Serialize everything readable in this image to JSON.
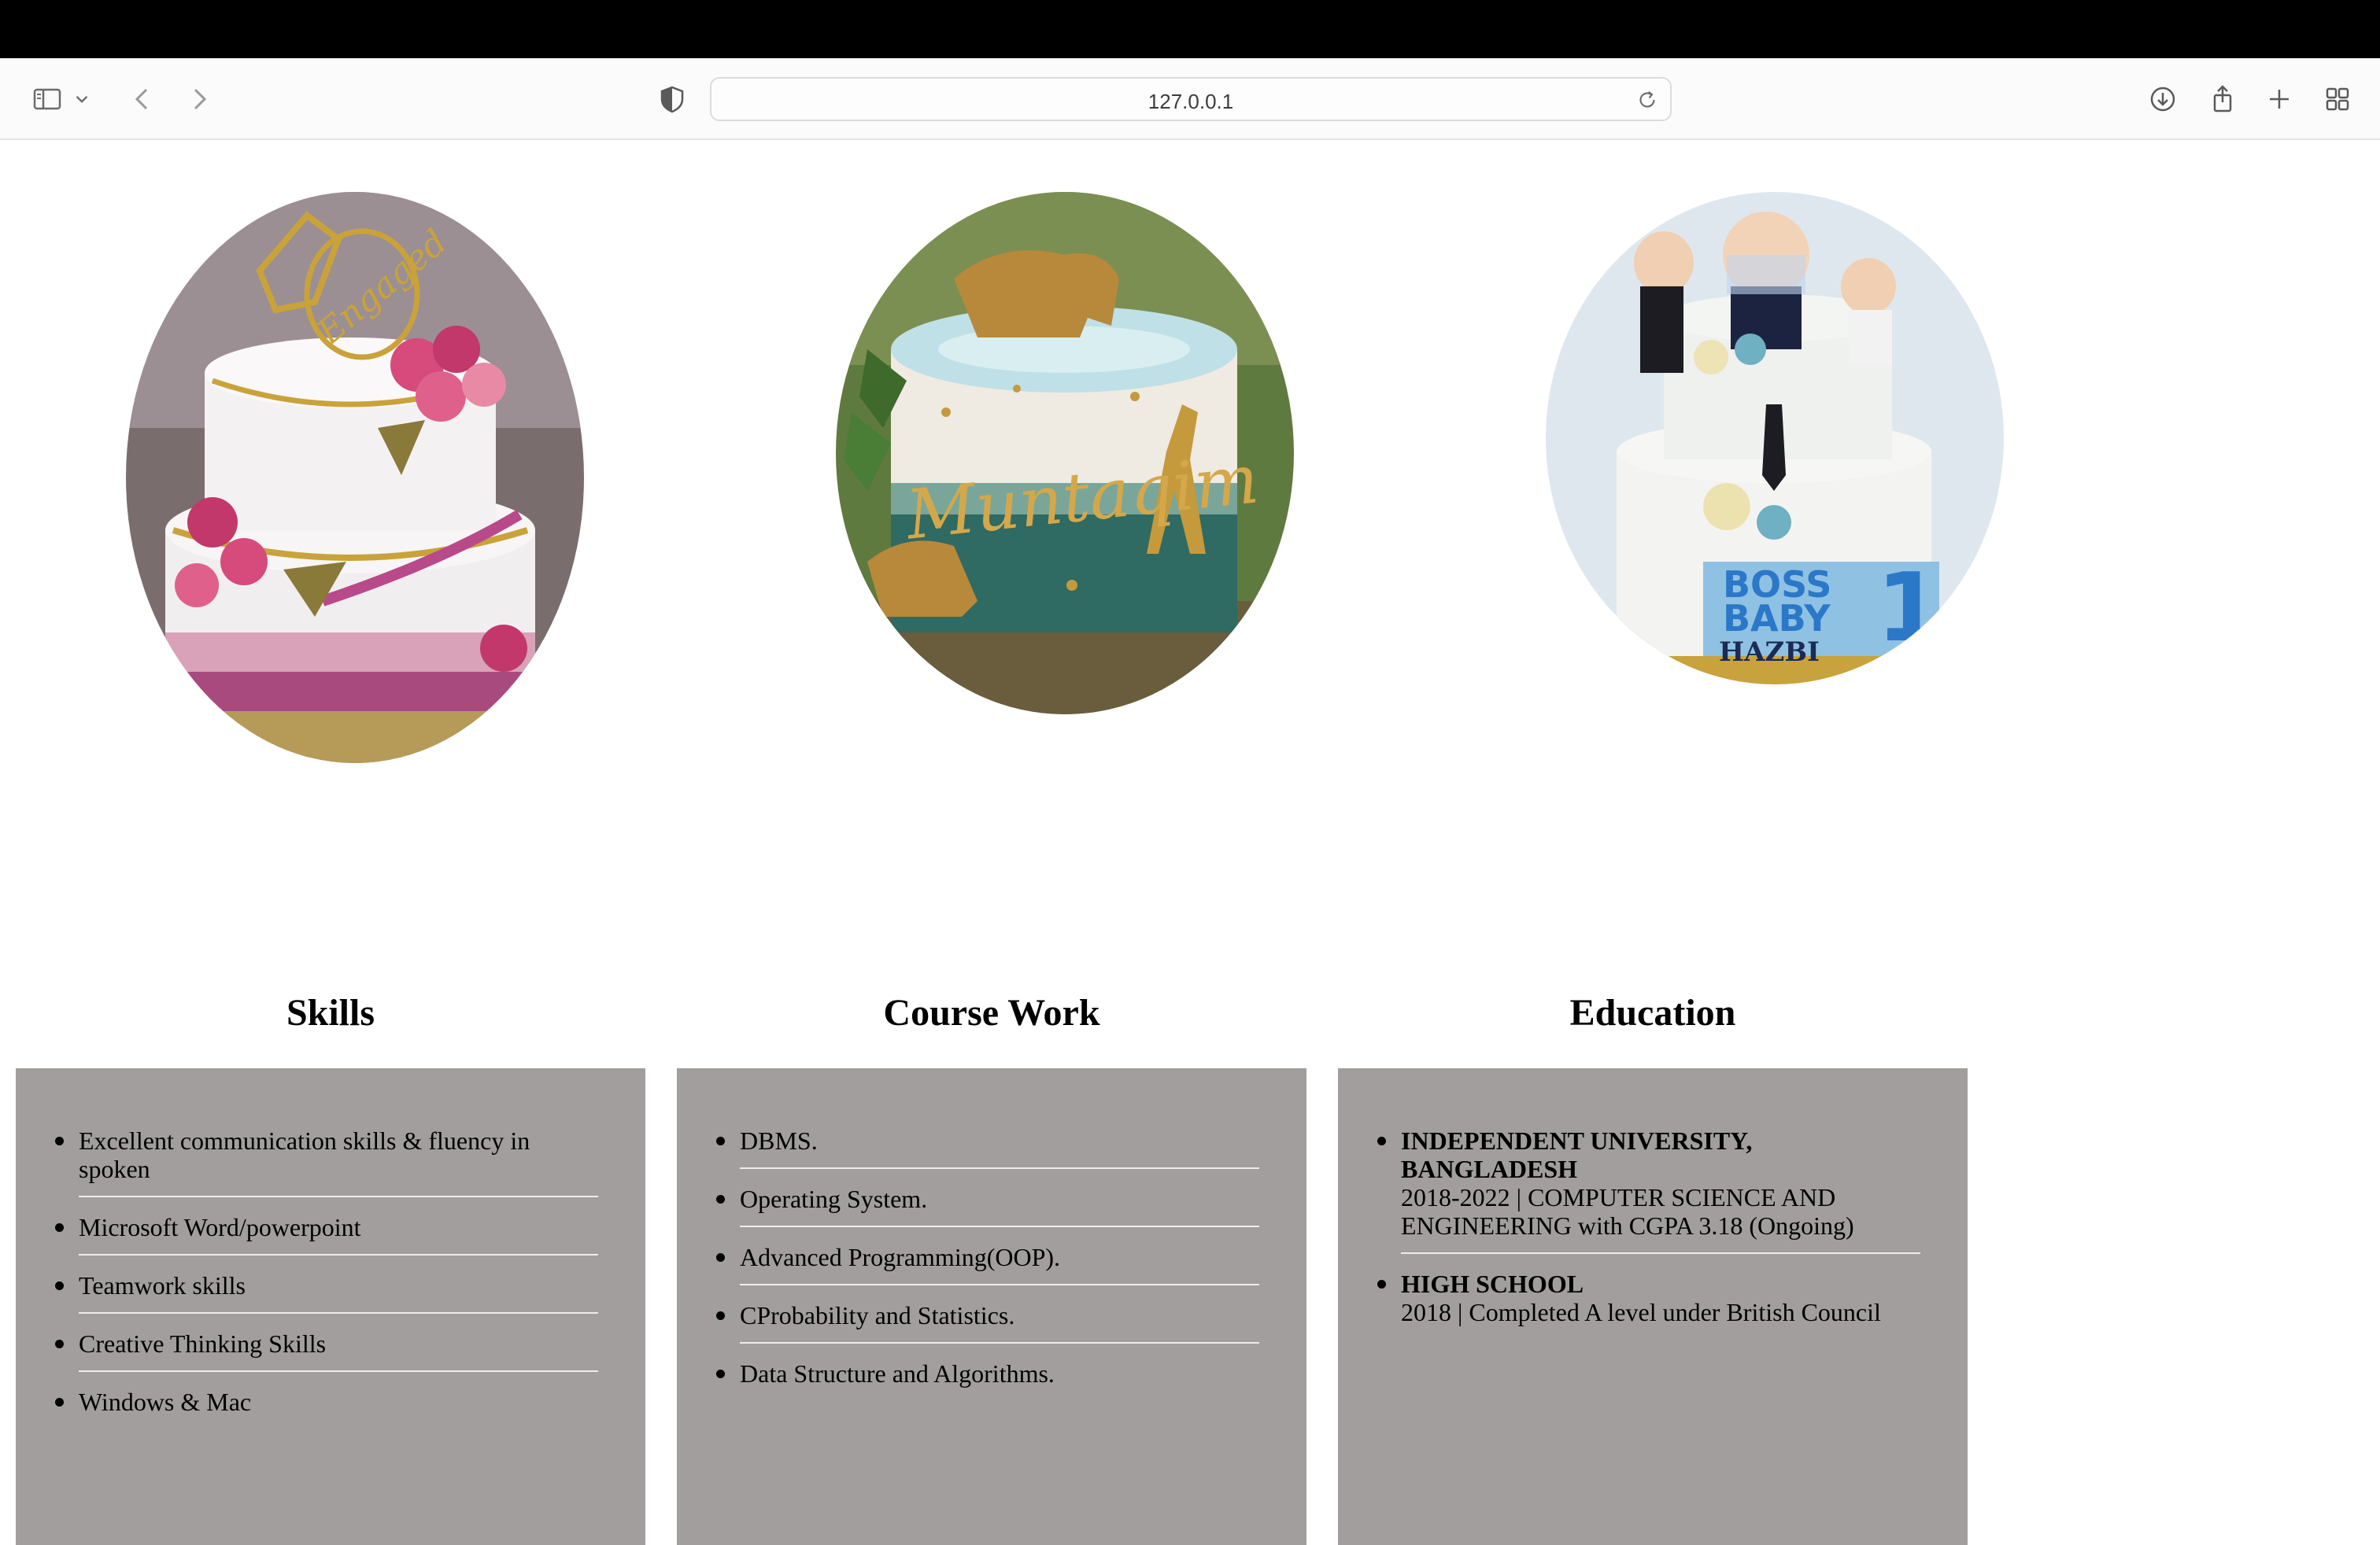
{
  "browser": {
    "url": "127.0.0.1"
  },
  "images": [
    {
      "alt": "engagement-cake",
      "colors": [
        "#f2eff0",
        "#d64a7c",
        "#c9a23a",
        "#6b5a55"
      ]
    },
    {
      "alt": "muntaqim-cake",
      "colors": [
        "#2f6a63",
        "#f1ede4",
        "#c49a3c",
        "#4a6d2f"
      ]
    },
    {
      "alt": "boss-baby-hazbi-cake",
      "colors": [
        "#eaf2f8",
        "#5aa7d8",
        "#c9a23a",
        "#1c2340"
      ]
    }
  ],
  "cake_texts": {
    "cake1_topper": "Engaged",
    "cake2_name": "Muntaqim",
    "cake3_line1": "BOSS",
    "cake3_line2": "BABY",
    "cake3_name": "HAZBI",
    "cake3_number": "1"
  },
  "sections": {
    "skills": {
      "title": "Skills",
      "items": [
        "Excellent communication skills & fluency in spoken",
        "Microsoft Word/powerpoint",
        "Teamwork skills",
        "Creative Thinking Skills",
        "Windows & Mac"
      ]
    },
    "coursework": {
      "title": "Course Work",
      "items": [
        "DBMS.",
        "Operating System.",
        "Advanced Programming(OOP).",
        "CProbability and Statistics.",
        "Data Structure and Algorithms."
      ]
    },
    "education": {
      "title": "Education",
      "items": [
        {
          "name": "INDEPENDENT UNIVERSITY, BANGLADESH",
          "detail": "2018-2022 | COMPUTER SCIENCE AND ENGINEERING with CGPA 3.18 (Ongoing)"
        },
        {
          "name": "HIGH SCHOOL",
          "detail": "2018 | Completed A level under British Council"
        }
      ]
    }
  },
  "colors": {
    "box_background": "#a19e9d",
    "divider": "#ededed"
  }
}
